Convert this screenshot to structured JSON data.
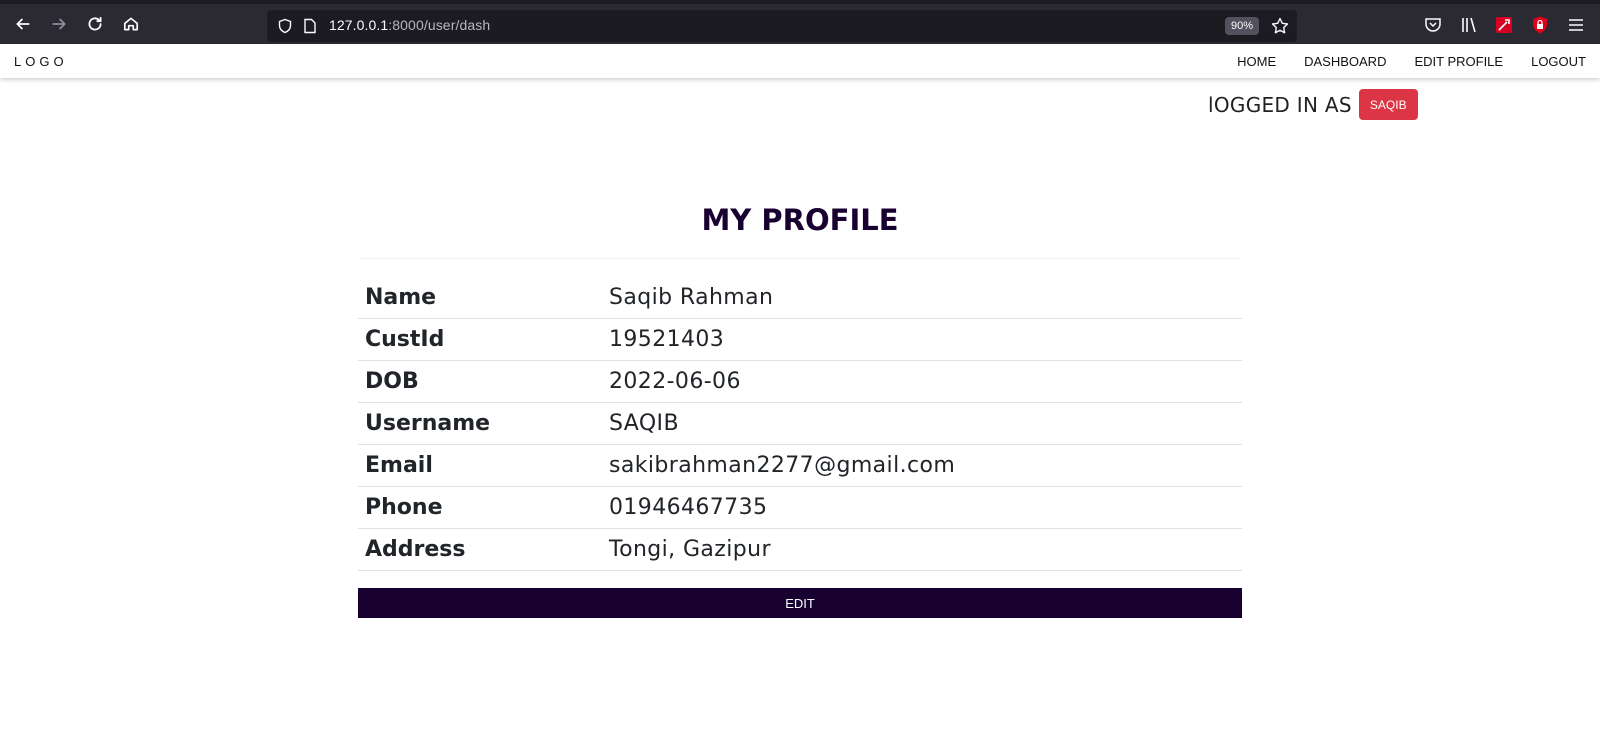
{
  "browser": {
    "url_host": "127.0.0.1",
    "url_path": ":8000/user/dash",
    "zoom": "90%",
    "icons": [
      "back-icon",
      "forward-icon",
      "reload-icon",
      "home-icon",
      "shield-icon",
      "page-icon",
      "star-icon",
      "pocket-icon",
      "library-icon",
      "extension-icon",
      "ublock-icon",
      "menu-icon"
    ]
  },
  "navbar": {
    "logo": "LOGO",
    "links": [
      "HOME",
      "DASHBOARD",
      "EDIT PROFILE",
      "LOGOUT"
    ]
  },
  "session": {
    "logged_in_label": "lOGGED IN AS",
    "username_badge": "SAQIB",
    "badge_color": "#dc3545"
  },
  "profile": {
    "title": "MY PROFILE",
    "rows": [
      {
        "label": "Name",
        "value": "Saqib Rahman"
      },
      {
        "label": "CustId",
        "value": "19521403"
      },
      {
        "label": "DOB",
        "value": "2022-06-06"
      },
      {
        "label": "Username",
        "value": "SAQIB"
      },
      {
        "label": "Email",
        "value": "sakibrahman2277@gmail.com"
      },
      {
        "label": "Phone",
        "value": "01946467735"
      },
      {
        "label": "Address",
        "value": "Tongi, Gazipur"
      }
    ],
    "edit_label": "EDIT",
    "accent_color": "#180030"
  }
}
